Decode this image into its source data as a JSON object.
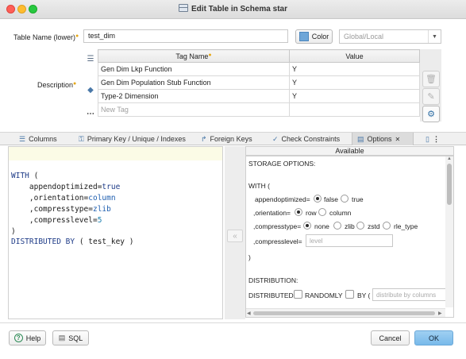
{
  "window": {
    "title": "Edit Table in Schema star"
  },
  "form": {
    "table_name_label": "Table Name (lower)",
    "table_name_value": "test_dim",
    "color_button": "Color",
    "scope_placeholder": "Global/Local",
    "description_label": "Description"
  },
  "tags": {
    "headers": [
      "Tag Name",
      "Value"
    ],
    "rows": [
      {
        "name": "Gen Dim Lkp Function",
        "value": "Y"
      },
      {
        "name": "Gen Dim Population Stub Function",
        "value": "Y"
      },
      {
        "name": "Type-2 Dimension",
        "value": "Y"
      }
    ],
    "new_tag_placeholder": "New Tag"
  },
  "tabs": [
    {
      "label": "Columns",
      "icon": "list-icon"
    },
    {
      "label": "Primary Key / Unique / Indexes",
      "icon": "key-icon"
    },
    {
      "label": "Foreign Keys",
      "icon": "arrow-icon"
    },
    {
      "label": "Check Constraints",
      "icon": "check-circle-icon"
    },
    {
      "label": "Options",
      "icon": "options-icon",
      "active": true,
      "close": "✕"
    }
  ],
  "sql": {
    "with_kw": "WITH",
    "paren_open": "(",
    "opt1_key": "appendoptimized",
    "opt1_val": "true",
    "opt2_key": "orientation",
    "opt2_val": "column",
    "opt3_key": "compresstype",
    "opt3_val": "zlib",
    "opt4_key": "compresslevel",
    "opt4_val": "5",
    "paren_close": ")",
    "distributed_kw": "DISTRIBUTED BY",
    "dist_key": "( test_key )"
  },
  "available": {
    "header": "Available",
    "storage_options": "STORAGE OPTIONS:",
    "with_open": "WITH (",
    "appendoptimized_label": "appendoptimized=",
    "appendoptimized_options": [
      "false",
      "true"
    ],
    "orientation_label": ",orientation=",
    "orientation_options": [
      "row",
      "column"
    ],
    "compresstype_label": ",compresstype=",
    "compresstype_options": [
      "none",
      "zlib",
      "zstd",
      "rle_type"
    ],
    "compresslevel_label": ",compresslevel=",
    "compresslevel_placeholder": "level",
    "close_paren": ")",
    "distribution": "DISTRIBUTION:",
    "distributed_label": "DISTRIBUTED",
    "randomly_label": "RANDOMLY",
    "by_label": "BY (",
    "by_placeholder": "distribute by columns"
  },
  "buttons": {
    "help": "Help",
    "sql": "SQL",
    "cancel": "Cancel",
    "ok": "OK"
  }
}
